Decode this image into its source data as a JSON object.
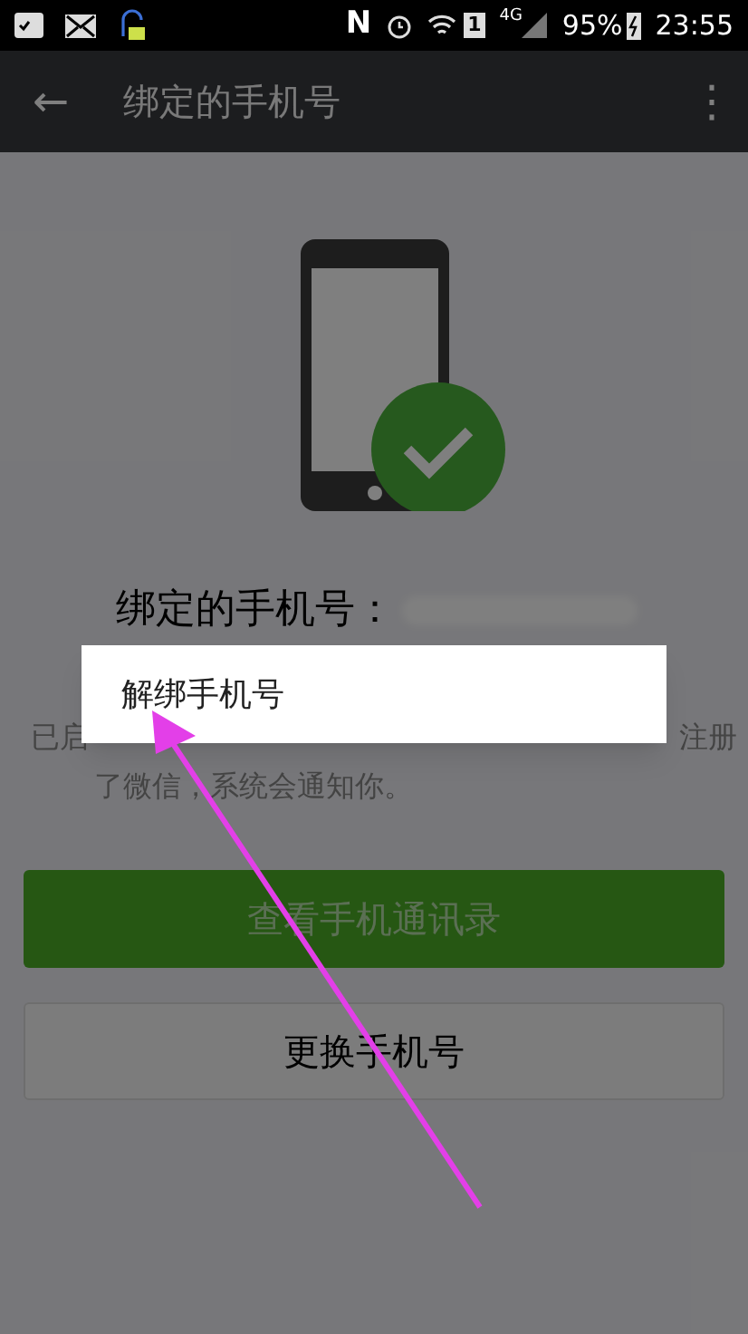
{
  "status_bar": {
    "nfc": "N",
    "sim": "1",
    "network": "4G",
    "battery": "95%",
    "time": "23:55"
  },
  "app_bar": {
    "back": "←",
    "title": "绑定的手机号",
    "more": "⋮"
  },
  "content": {
    "heading": "绑定的手机号：",
    "description_start": "已启",
    "description_end": "注册",
    "description_line2": "了微信，系统会通知你。"
  },
  "buttons": [
    {
      "label": "查看手机通讯录",
      "kind": "primary"
    },
    {
      "label": "更换手机号",
      "kind": "default"
    }
  ],
  "popup_menu": {
    "items": [
      {
        "label": "解绑手机号"
      }
    ]
  }
}
